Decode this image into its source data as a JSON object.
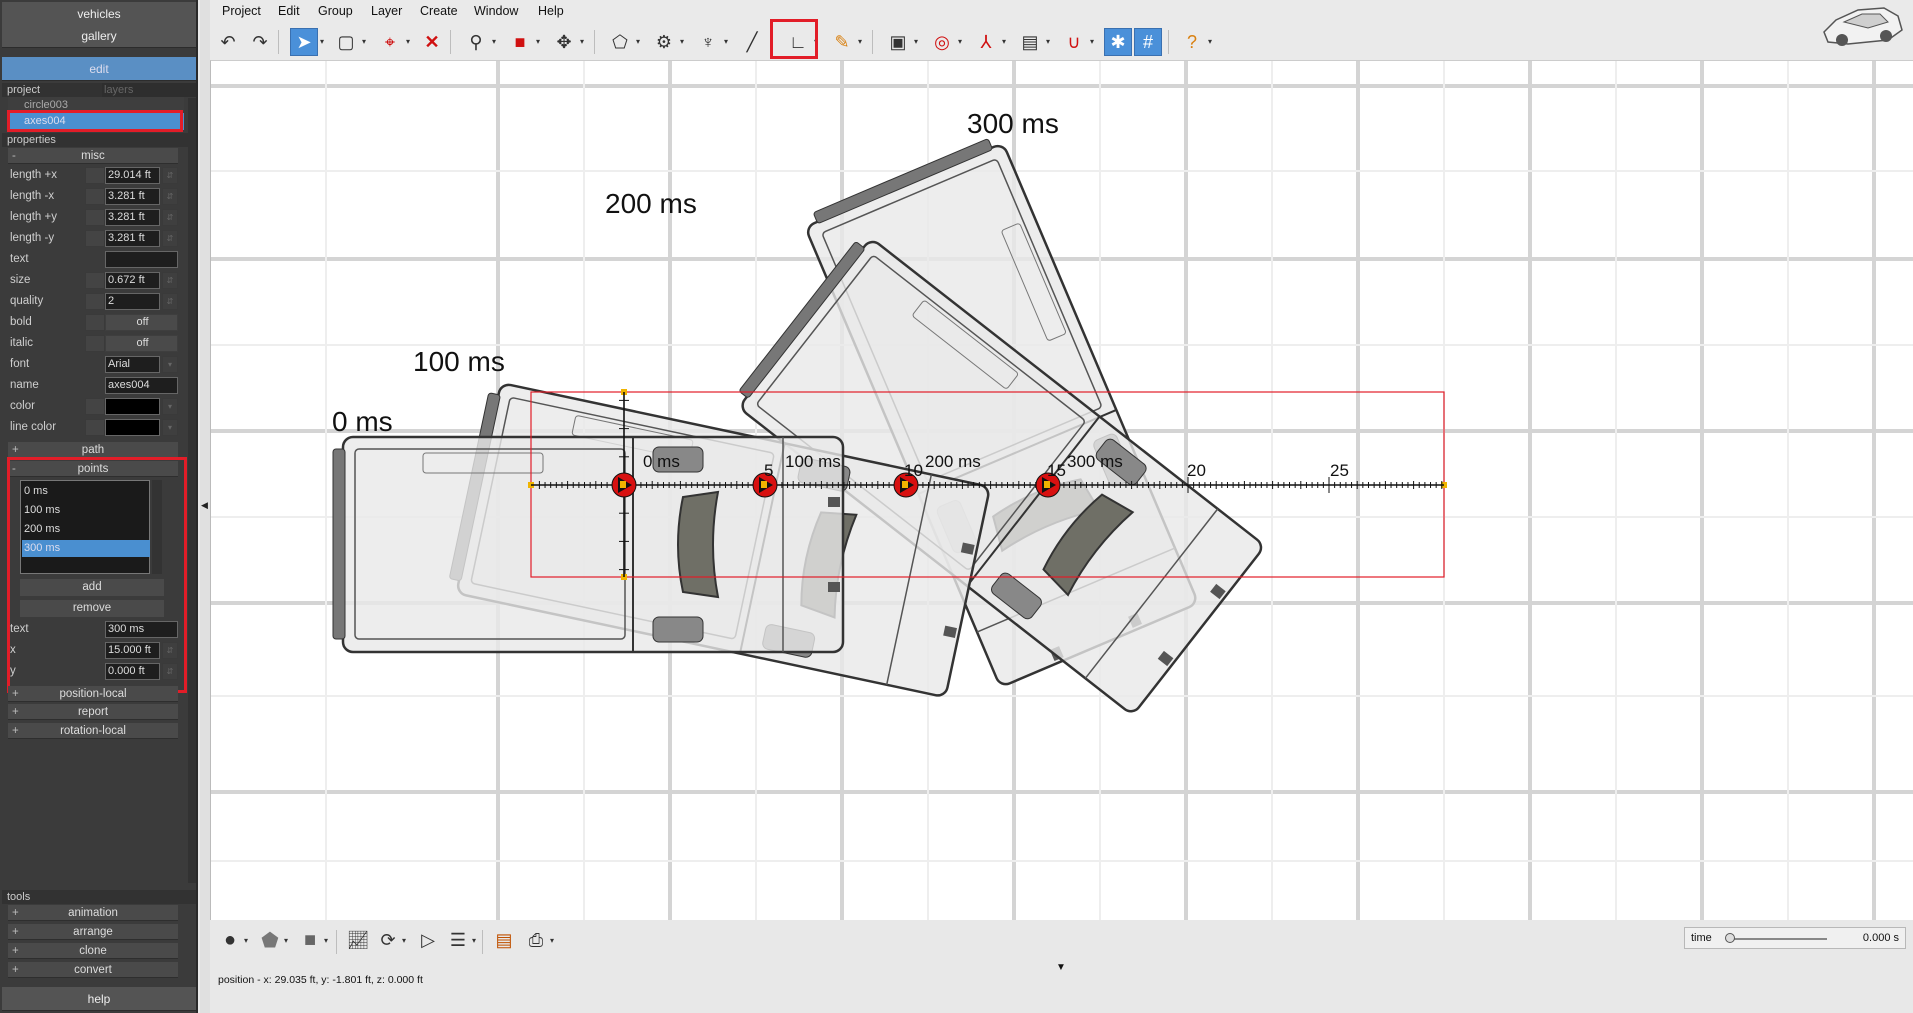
{
  "left_panel": {
    "top_buttons": [
      "vehicles",
      "gallery",
      "edit"
    ],
    "tabs": {
      "project": "project",
      "layers": "layers"
    },
    "project_items": [
      "circle003",
      "axes004"
    ],
    "properties_header": "properties",
    "misc_group": {
      "label": "misc",
      "toggle": "-"
    },
    "properties": [
      {
        "label": "length +x",
        "value": "29.014 ft"
      },
      {
        "label": "length -x",
        "value": "3.281 ft"
      },
      {
        "label": "length +y",
        "value": "3.281 ft"
      },
      {
        "label": "length -y",
        "value": "3.281 ft"
      },
      {
        "label": "text",
        "value": ""
      },
      {
        "label": "size",
        "value": "0.672 ft"
      },
      {
        "label": "quality",
        "value": "2"
      },
      {
        "label": "bold",
        "value": "off"
      },
      {
        "label": "italic",
        "value": "off"
      },
      {
        "label": "font",
        "value": "Arial"
      },
      {
        "label": "name",
        "value": "axes004"
      },
      {
        "label": "color",
        "value": ""
      },
      {
        "label": "line color",
        "value": ""
      }
    ],
    "path_group": {
      "label": "path",
      "toggle": "+"
    },
    "points_group": {
      "label": "points",
      "toggle": "-"
    },
    "points_list": [
      "0 ms",
      "100 ms",
      "200 ms",
      "300 ms"
    ],
    "selected_point": "300 ms",
    "add_label": "add",
    "remove_label": "remove",
    "point_props": [
      {
        "label": "text",
        "value": "300 ms"
      },
      {
        "label": "x",
        "value": "15.000 ft"
      },
      {
        "label": "y",
        "value": "0.000 ft"
      }
    ],
    "other_groups": [
      {
        "label": "position-local",
        "toggle": "+"
      },
      {
        "label": "report",
        "toggle": "+"
      },
      {
        "label": "rotation-local",
        "toggle": "+"
      }
    ],
    "tools_header": "tools",
    "tools": [
      {
        "label": "animation",
        "toggle": "+"
      },
      {
        "label": "arrange",
        "toggle": "+"
      },
      {
        "label": "clone",
        "toggle": "+"
      },
      {
        "label": "convert",
        "toggle": "+"
      }
    ],
    "help_label": "help"
  },
  "menu": [
    "Project",
    "Edit",
    "Group",
    "Layer",
    "Create",
    "Window",
    "Help"
  ],
  "canvas": {
    "labels": {
      "t0": "0 ms",
      "t1": "100 ms",
      "t2": "200 ms",
      "t3": "300 ms"
    },
    "axis_point_labels": {
      "p0": "0 ms",
      "p1": "100 ms",
      "p2": "200 ms",
      "p3": "300 ms"
    },
    "axis_ticks": {
      "t5": "5",
      "t10": "10",
      "t15": "15",
      "t20": "20",
      "t25": "25"
    }
  },
  "status": {
    "position": "position - x: 29.035 ft, y: -1.801 ft, z: 0.000 ft",
    "time_label": "time",
    "time_value": "0.000 s"
  },
  "colors": {
    "accent": "#4a90d9",
    "highlight": "#e21d28",
    "panel": "#3b3b3b"
  }
}
